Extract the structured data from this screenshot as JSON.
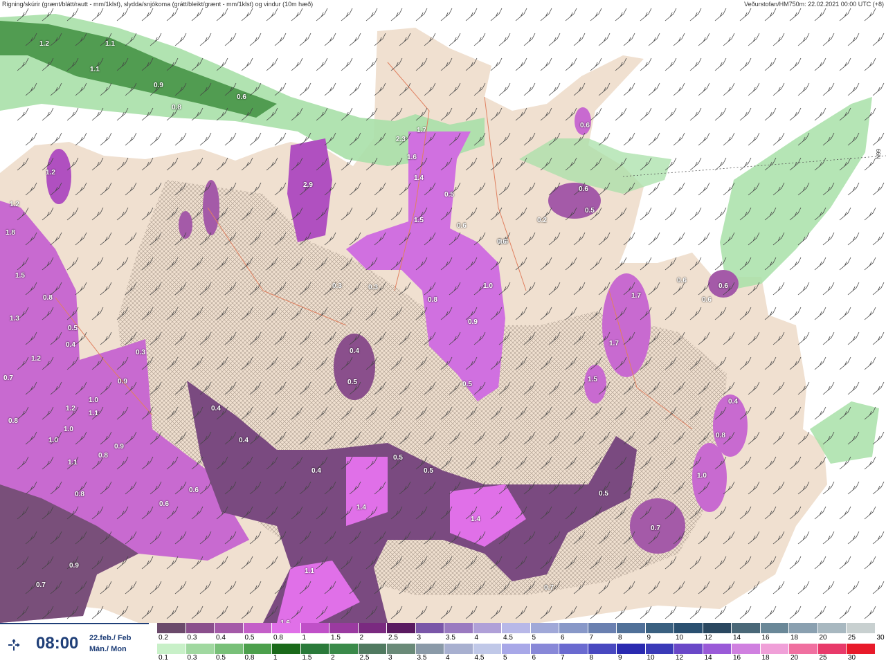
{
  "header": {
    "left_title": "Rigning/skúrir (grænt/blátt/rautt - mm/1klst), slydda/snjókoma (grátt/bleikt/grænt - mm/1klst) og vindur (10m hæð)",
    "right_title": "Veðurstofan/HM750m: 22.02.2021 00:00 UTC (+8)"
  },
  "latitude_label": "66N",
  "timebox": {
    "icon": "wind-arrows-icon",
    "time": "08:00",
    "date_line1": "22.feb./ Feb",
    "date_line2": "Mán./ Mon"
  },
  "legend": {
    "snow_labels": [
      "0.2",
      "0.3",
      "0.4",
      "0.5",
      "0.8",
      "1",
      "1.5",
      "2",
      "2.5",
      "3",
      "3.5",
      "4",
      "4.5",
      "5",
      "6",
      "7",
      "8",
      "9",
      "10",
      "12",
      "14",
      "16",
      "18",
      "20",
      "25",
      "30"
    ],
    "snow_colors": [
      "#6b4a6b",
      "#8a4f8c",
      "#a45aa8",
      "#c45fc8",
      "#e070e8",
      "#c050c8",
      "#9a3aa0",
      "#7a2a80",
      "#5a1a60",
      "#7a56a8",
      "#9a7ac0",
      "#b0a0d8",
      "#b8b8e8",
      "#a0a8d8",
      "#8898c8",
      "#6a80b0",
      "#507098",
      "#3a6080",
      "#2a5070",
      "#2a4860",
      "#4a6878",
      "#6a8898",
      "#8aa0b0",
      "#a8b8c0",
      "#c8d0d0",
      "#ffffff"
    ],
    "rain_labels": [
      "0.1",
      "0.3",
      "0.5",
      "0.8",
      "1",
      "1.5",
      "2",
      "2.5",
      "3",
      "3.5",
      "4",
      "4.5",
      "5",
      "6",
      "7",
      "8",
      "9",
      "10",
      "12",
      "14",
      "16",
      "18",
      "20",
      "25",
      "30"
    ],
    "rain_colors": [
      "#c8f0c8",
      "#a0d8a0",
      "#78c078",
      "#4ca04c",
      "#1a6a1a",
      "#2a7a3a",
      "#3a8a4a",
      "#507a60",
      "#6a8a78",
      "#8a9aa8",
      "#a8b0d0",
      "#c0c8e8",
      "#a8a8e8",
      "#8888d8",
      "#6a6ad0",
      "#4848c0",
      "#2a2ab0",
      "#3a3ab8",
      "#6a48c8",
      "#9a5ad8",
      "#d080e0",
      "#f0a0d8",
      "#f070a0",
      "#e83a6a",
      "#e81a2a"
    ]
  },
  "map_labels": [
    {
      "t": "1.2"
    },
    {
      "t": "1.1"
    },
    {
      "t": "1.1"
    },
    {
      "t": "0.9"
    },
    {
      "t": "0.8"
    },
    {
      "t": "0.6"
    },
    {
      "t": "2.9"
    },
    {
      "t": "2.3"
    },
    {
      "t": "1.7"
    },
    {
      "t": "1.6"
    },
    {
      "t": "1.4"
    },
    {
      "t": "1.5"
    },
    {
      "t": "0.5"
    },
    {
      "t": "0.6"
    },
    {
      "t": "0.6"
    },
    {
      "t": "0.6"
    },
    {
      "t": "0.2"
    },
    {
      "t": "0.6"
    },
    {
      "t": "0.5"
    },
    {
      "t": "1.2"
    },
    {
      "t": "1.2"
    },
    {
      "t": "1.8"
    },
    {
      "t": "1.5"
    },
    {
      "t": "0.8"
    },
    {
      "t": "1.3"
    },
    {
      "t": "0.5"
    },
    {
      "t": "0.4"
    },
    {
      "t": "1.2"
    },
    {
      "t": "0.7"
    },
    {
      "t": "0.9"
    },
    {
      "t": "1.0"
    },
    {
      "t": "1.1"
    },
    {
      "t": "1.2"
    },
    {
      "t": "0.8"
    },
    {
      "t": "1.0"
    },
    {
      "t": "1.0"
    },
    {
      "t": "1.1"
    },
    {
      "t": "0.9"
    },
    {
      "t": "0.8"
    },
    {
      "t": "0.6"
    },
    {
      "t": "0.9"
    },
    {
      "t": "0.7"
    },
    {
      "t": "0.3"
    },
    {
      "t": "0.4"
    },
    {
      "t": "0.4"
    },
    {
      "t": "0.4"
    },
    {
      "t": "1.4"
    },
    {
      "t": "1.4"
    },
    {
      "t": "0.5"
    },
    {
      "t": "0.5"
    },
    {
      "t": "0.8"
    },
    {
      "t": "1.0"
    },
    {
      "t": "0.9"
    },
    {
      "t": "0.5"
    },
    {
      "t": "1.7"
    },
    {
      "t": "1.7"
    },
    {
      "t": "1.5"
    },
    {
      "t": "0.6"
    },
    {
      "t": "0.4"
    },
    {
      "t": "0.8"
    },
    {
      "t": "1.0"
    },
    {
      "t": "0.5"
    },
    {
      "t": "0.7"
    },
    {
      "t": "0.7"
    },
    {
      "t": "0.3"
    },
    {
      "t": "0.3"
    },
    {
      "t": "0.4"
    },
    {
      "t": "0.5"
    },
    {
      "t": "0.6"
    },
    {
      "t": "0.6"
    },
    {
      "t": "0.6"
    },
    {
      "t": "1.1"
    },
    {
      "t": "1.6"
    },
    {
      "t": "0.8"
    },
    {
      "t": "0.6"
    }
  ]
}
